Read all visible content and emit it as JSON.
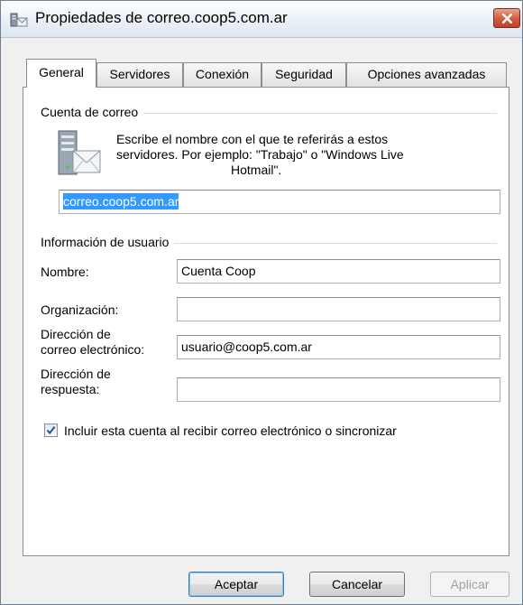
{
  "window": {
    "title": "Propiedades de correo.coop5.com.ar",
    "icon": "mail-account-icon",
    "close_icon": "close-icon"
  },
  "tabs": [
    {
      "label": "General",
      "active": true
    },
    {
      "label": "Servidores",
      "active": false
    },
    {
      "label": "Conexión",
      "active": false
    },
    {
      "label": "Seguridad",
      "active": false
    },
    {
      "label": "Opciones avanzadas",
      "active": false
    }
  ],
  "mail_account": {
    "group_title": "Cuenta de correo",
    "description": [
      "Escribe el nombre con el que te referirás a estos",
      "servidores. Por ejemplo: \"Trabajo\" o \"Windows Live",
      "Hotmail\"."
    ],
    "account_name": "correo.coop5.com.ar",
    "account_name_selected": true
  },
  "user_info": {
    "group_title": "Información de usuario",
    "name_label": "Nombre:",
    "name_value": "Cuenta Coop",
    "organization_label": "Organización:",
    "organization_value": "",
    "email_label": [
      "Dirección de",
      "correo electrónico:"
    ],
    "email_value": "usuario@coop5.com.ar",
    "reply_label": [
      "Dirección de",
      "respuesta:"
    ],
    "reply_value": ""
  },
  "include_account": {
    "label": "Incluir esta cuenta al recibir correo electrónico o sincronizar",
    "checked": true
  },
  "buttons": {
    "ok": "Aceptar",
    "cancel": "Cancelar",
    "apply": "Aplicar",
    "apply_disabled": true
  },
  "colors": {
    "selection": "#3399ff",
    "checkmark": "#2a4f9c",
    "close_button": "#c94a32"
  }
}
